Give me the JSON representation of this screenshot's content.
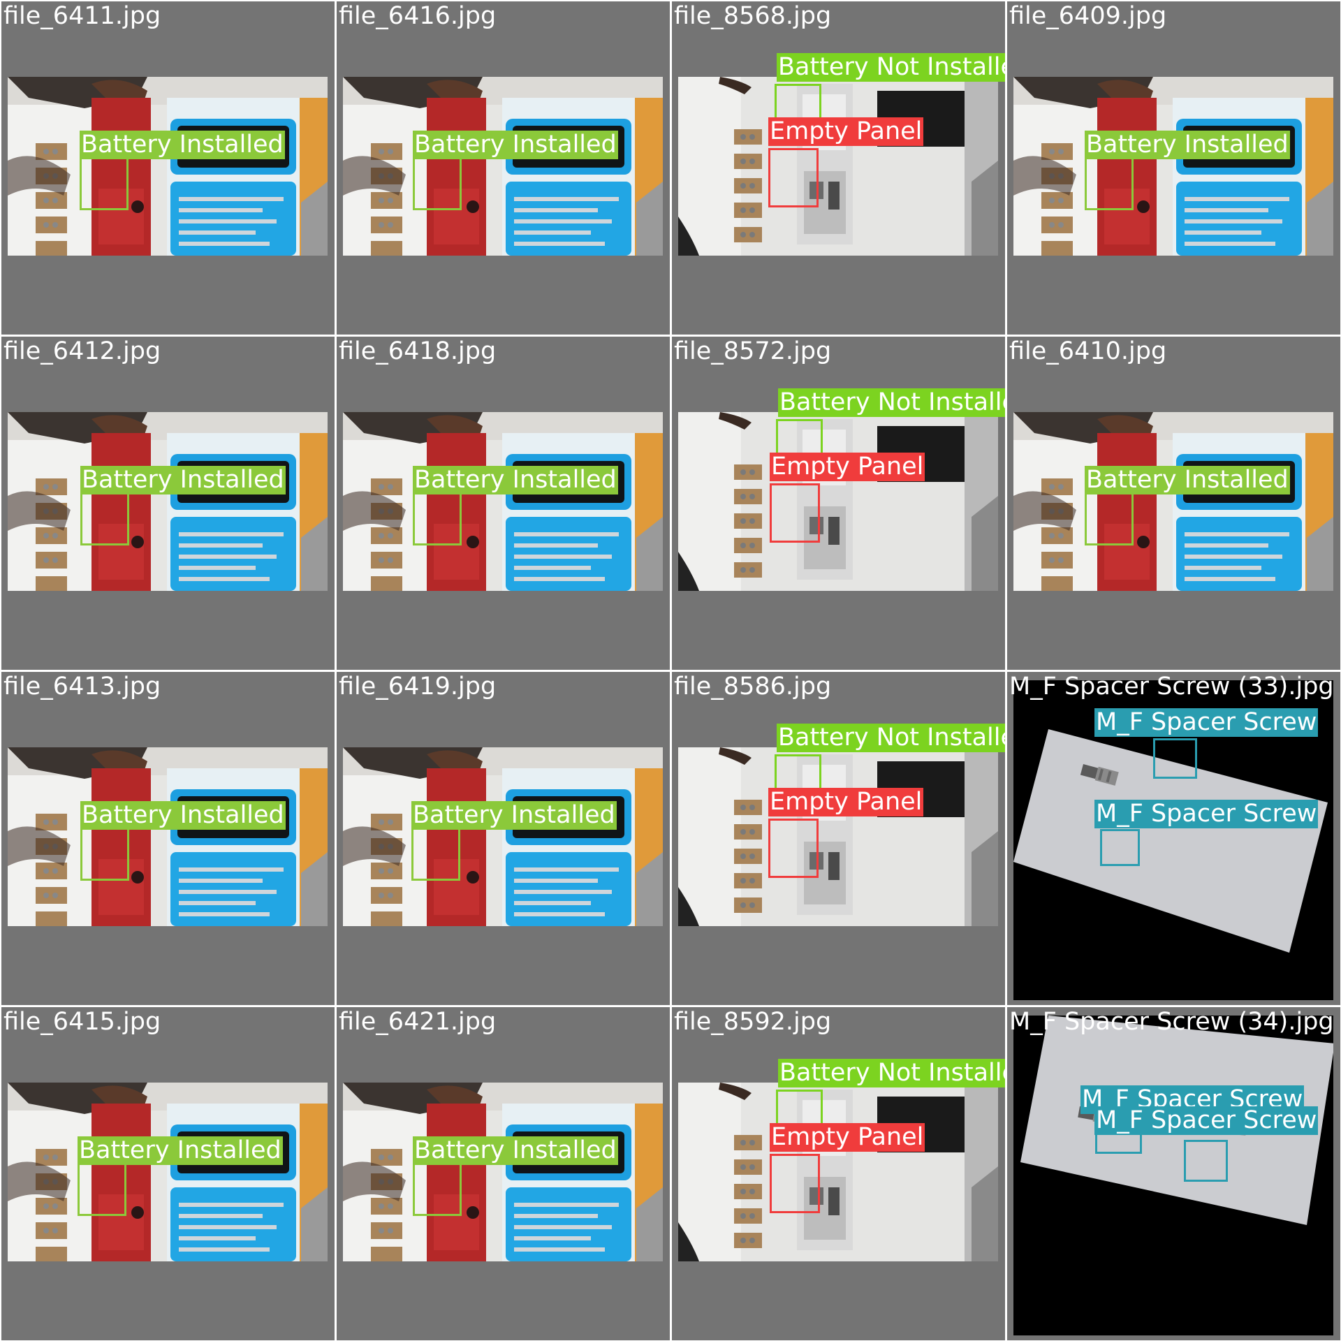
{
  "colors": {
    "background": "#747474",
    "battery_installed": "#8bc93a",
    "battery_not_installed": "#7cd320",
    "empty_panel": "#f03c3c",
    "spacer_screw": "#2a9db0"
  },
  "tiles": [
    {
      "filename": "file_6411.jpg",
      "scene": "tools",
      "detections": [
        {
          "label": "Battery Installed",
          "class": "battery_installed"
        }
      ]
    },
    {
      "filename": "file_6416.jpg",
      "scene": "tools",
      "detections": [
        {
          "label": "Battery Installed",
          "class": "battery_installed"
        }
      ]
    },
    {
      "filename": "file_8568.jpg",
      "scene": "panel",
      "detections": [
        {
          "label": "Battery Not Installed",
          "class": "battery_not_installed"
        },
        {
          "label": "Empty Panel",
          "class": "empty_panel"
        }
      ]
    },
    {
      "filename": "file_6409.jpg",
      "scene": "tools",
      "detections": [
        {
          "label": "Battery Installed",
          "class": "battery_installed"
        }
      ]
    },
    {
      "filename": "file_6412.jpg",
      "scene": "tools",
      "detections": [
        {
          "label": "Battery Installed",
          "class": "battery_installed"
        }
      ]
    },
    {
      "filename": "file_6418.jpg",
      "scene": "tools",
      "detections": [
        {
          "label": "Battery Installed",
          "class": "battery_installed"
        }
      ]
    },
    {
      "filename": "file_8572.jpg",
      "scene": "panel",
      "detections": [
        {
          "label": "Battery Not Installed",
          "class": "battery_not_installed"
        },
        {
          "label": "Empty Panel",
          "class": "empty_panel"
        }
      ]
    },
    {
      "filename": "file_6410.jpg",
      "scene": "tools",
      "detections": [
        {
          "label": "Battery Installed",
          "class": "battery_installed"
        }
      ]
    },
    {
      "filename": "file_6413.jpg",
      "scene": "tools",
      "detections": [
        {
          "label": "Battery Installed",
          "class": "battery_installed"
        }
      ]
    },
    {
      "filename": "file_6419.jpg",
      "scene": "tools",
      "detections": [
        {
          "label": "Battery Installed",
          "class": "battery_installed"
        }
      ]
    },
    {
      "filename": "file_8586.jpg",
      "scene": "panel",
      "detections": [
        {
          "label": "Battery Not Installed",
          "class": "battery_not_installed"
        },
        {
          "label": "Empty Panel",
          "class": "empty_panel"
        }
      ]
    },
    {
      "filename": "M_F Spacer Screw (33).jpg",
      "scene": "screw",
      "detections": [
        {
          "label": "M_F Spacer Screw",
          "class": "spacer_screw"
        },
        {
          "label": "M_F Spacer Screw",
          "class": "spacer_screw"
        }
      ]
    },
    {
      "filename": "file_6415.jpg",
      "scene": "tools",
      "detections": [
        {
          "label": "Battery Installed",
          "class": "battery_installed"
        }
      ]
    },
    {
      "filename": "file_6421.jpg",
      "scene": "tools",
      "detections": [
        {
          "label": "Battery Installed",
          "class": "battery_installed"
        }
      ]
    },
    {
      "filename": "file_8592.jpg",
      "scene": "panel",
      "detections": [
        {
          "label": "Battery Not Installed",
          "class": "battery_not_installed"
        },
        {
          "label": "Empty Panel",
          "class": "empty_panel"
        }
      ]
    },
    {
      "filename": "M_F Spacer Screw (34).jpg",
      "scene": "screw",
      "detections": [
        {
          "label": "M_F Spacer Screw",
          "class": "spacer_screw"
        },
        {
          "label": "M_F Spacer Screw",
          "class": "spacer_screw"
        }
      ]
    }
  ]
}
